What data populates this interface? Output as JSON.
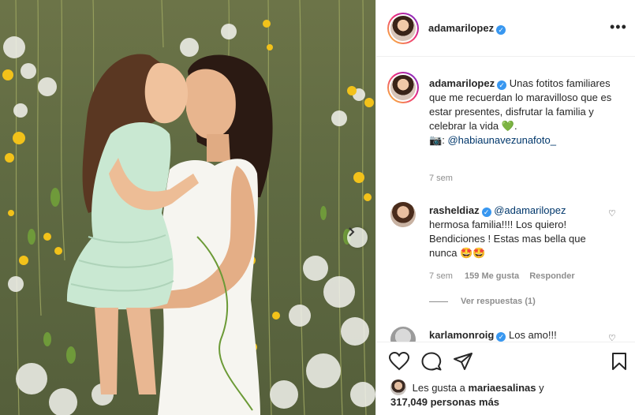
{
  "post": {
    "username": "adamarilopez",
    "more_icon": "more-horizontal-icon",
    "next_icon": "chevron-right-icon"
  },
  "caption": {
    "username": "adamarilopez",
    "text": "Unas fotitos familiares que me recuerdan lo maravilloso que es estar presentes, disfrutar la familia y celebrar la vida",
    "emoji": "💚",
    "period": ".",
    "camera_emoji": "📷",
    "mention_prefix": ":",
    "mention": "@habiaunavezunafoto_",
    "time": "7 sem"
  },
  "comments": [
    {
      "username": "rasheldiaz",
      "mention": "@adamarilopez",
      "text": "hermosa familia!!!! Los quiero! Bendiciones ! Estas mas bella que nunca",
      "emoji": "🤩🤩",
      "time": "7 sem",
      "likes": "159 Me gusta",
      "reply": "Responder",
      "view_replies": "Ver respuestas (1)"
    },
    {
      "username": "karlamonroig",
      "text": "Los amo!!!"
    }
  ],
  "actions": {
    "like_icon": "heart-icon",
    "comment_icon": "comment-icon",
    "share_icon": "paper-plane-icon",
    "save_icon": "bookmark-icon"
  },
  "likes": {
    "prefix": "Les gusta a",
    "user": "mariaesalinas",
    "connector": "y",
    "count": "317,049 personas más"
  },
  "colors": {
    "verified": "#3897f0",
    "link": "#00376b",
    "muted": "#8e8e8e",
    "background": "#6c7448"
  }
}
